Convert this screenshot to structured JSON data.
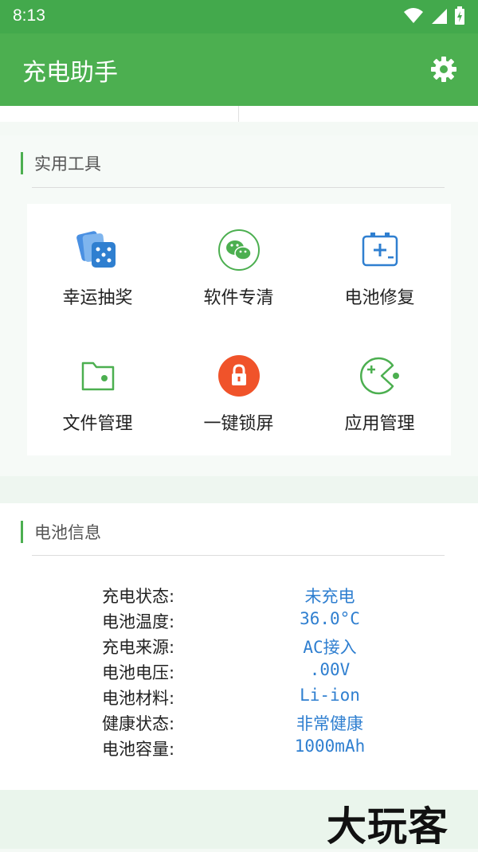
{
  "status": {
    "time": "8:13"
  },
  "app": {
    "title": "充电助手"
  },
  "tools": {
    "title": "实用工具",
    "items": [
      {
        "label": "幸运抽奖",
        "icon": "dice-cards-icon"
      },
      {
        "label": "软件专清",
        "icon": "wechat-icon"
      },
      {
        "label": "电池修复",
        "icon": "battery-repair-icon"
      },
      {
        "label": "文件管理",
        "icon": "folder-icon"
      },
      {
        "label": "一键锁屏",
        "icon": "lock-icon"
      },
      {
        "label": "应用管理",
        "icon": "pacman-app-icon"
      }
    ]
  },
  "battery": {
    "title": "电池信息",
    "rows": [
      {
        "label": "充电状态:",
        "value": "未充电"
      },
      {
        "label": "电池温度:",
        "value": "36.0°C"
      },
      {
        "label": "充电来源:",
        "value": "AC接入"
      },
      {
        "label": "电池电压:",
        "value": ".00V"
      },
      {
        "label": "电池材料:",
        "value": "Li-ion"
      },
      {
        "label": "健康状态:",
        "value": "非常健康"
      },
      {
        "label": "电池容量:",
        "value": "1000mAh"
      }
    ]
  },
  "watermark": "大玩客",
  "colors": {
    "primary": "#4caf50",
    "value_blue": "#2f7fd0",
    "lock_orange": "#f0532a"
  }
}
